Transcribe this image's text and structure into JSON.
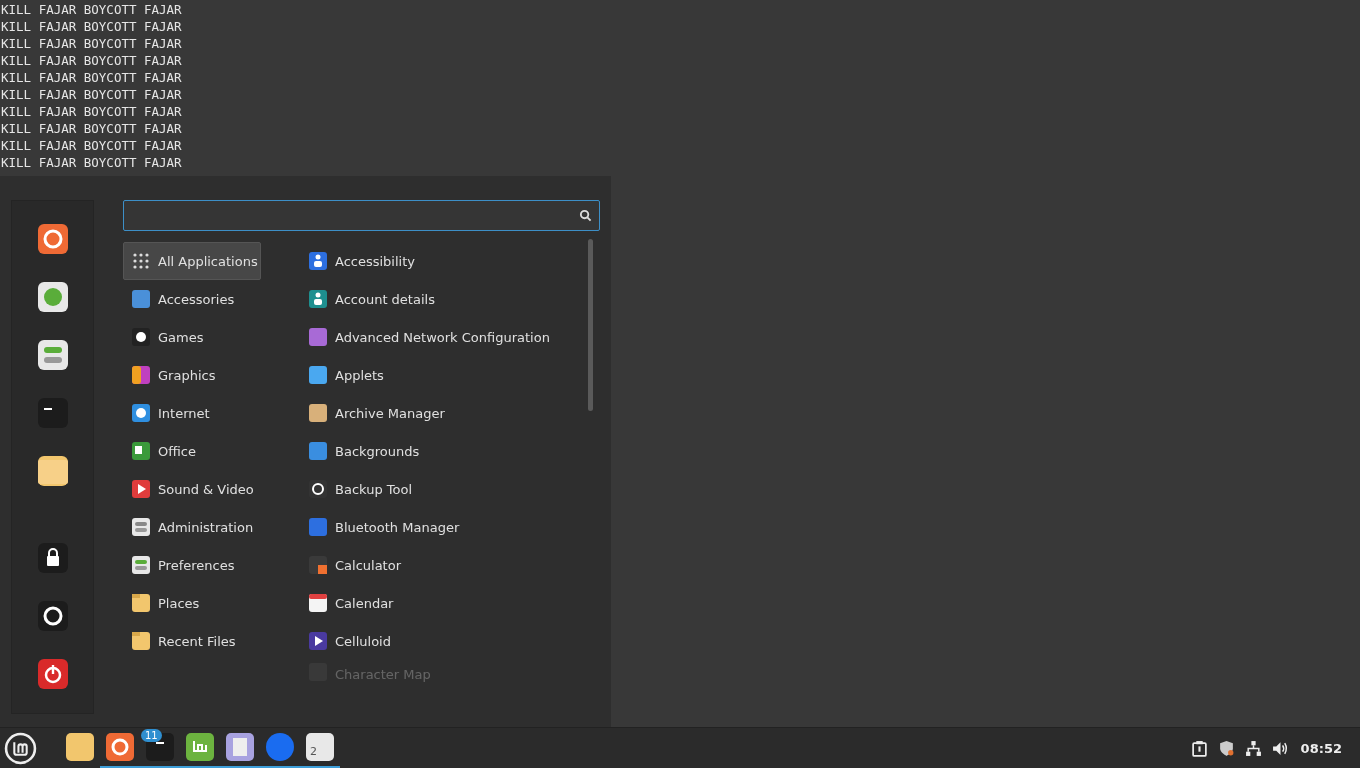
{
  "terminal": {
    "lines": [
      "KILL FAJAR BOYCOTT FAJAR",
      "KILL FAJAR BOYCOTT FAJAR",
      "KILL FAJAR BOYCOTT FAJAR",
      "KILL FAJAR BOYCOTT FAJAR",
      "KILL FAJAR BOYCOTT FAJAR",
      "KILL FAJAR BOYCOTT FAJAR",
      "KILL FAJAR BOYCOTT FAJAR",
      "KILL FAJAR BOYCOTT FAJAR",
      "KILL FAJAR BOYCOTT FAJAR",
      "KILL FAJAR BOYCOTT FAJAR"
    ]
  },
  "menu": {
    "categories": [
      {
        "label": "All Applications",
        "selected": true
      },
      {
        "label": "Accessories",
        "selected": false
      },
      {
        "label": "Games",
        "selected": false
      },
      {
        "label": "Graphics",
        "selected": false
      },
      {
        "label": "Internet",
        "selected": false
      },
      {
        "label": "Office",
        "selected": false
      },
      {
        "label": "Sound & Video",
        "selected": false
      },
      {
        "label": "Administration",
        "selected": false
      },
      {
        "label": "Preferences",
        "selected": false
      },
      {
        "label": "Places",
        "selected": false
      },
      {
        "label": "Recent Files",
        "selected": false
      }
    ],
    "applications": [
      {
        "label": "Accessibility",
        "faded": false
      },
      {
        "label": "Account details",
        "faded": false
      },
      {
        "label": "Advanced Network Configuration",
        "faded": false
      },
      {
        "label": "Applets",
        "faded": false
      },
      {
        "label": "Archive Manager",
        "faded": false
      },
      {
        "label": "Backgrounds",
        "faded": false
      },
      {
        "label": "Backup Tool",
        "faded": false
      },
      {
        "label": "Bluetooth Manager",
        "faded": false
      },
      {
        "label": "Calculator",
        "faded": false
      },
      {
        "label": "Calendar",
        "faded": false
      },
      {
        "label": "Celluloid",
        "faded": false
      },
      {
        "label": "Character Map",
        "faded": true
      }
    ]
  },
  "taskbar": {
    "apps": [
      {
        "running": false
      },
      {
        "running": true
      },
      {
        "running": true,
        "badge": "11"
      },
      {
        "running": true
      },
      {
        "running": true
      },
      {
        "running": true
      },
      {
        "running": true,
        "badge": "2"
      }
    ],
    "clock": "08:52"
  }
}
